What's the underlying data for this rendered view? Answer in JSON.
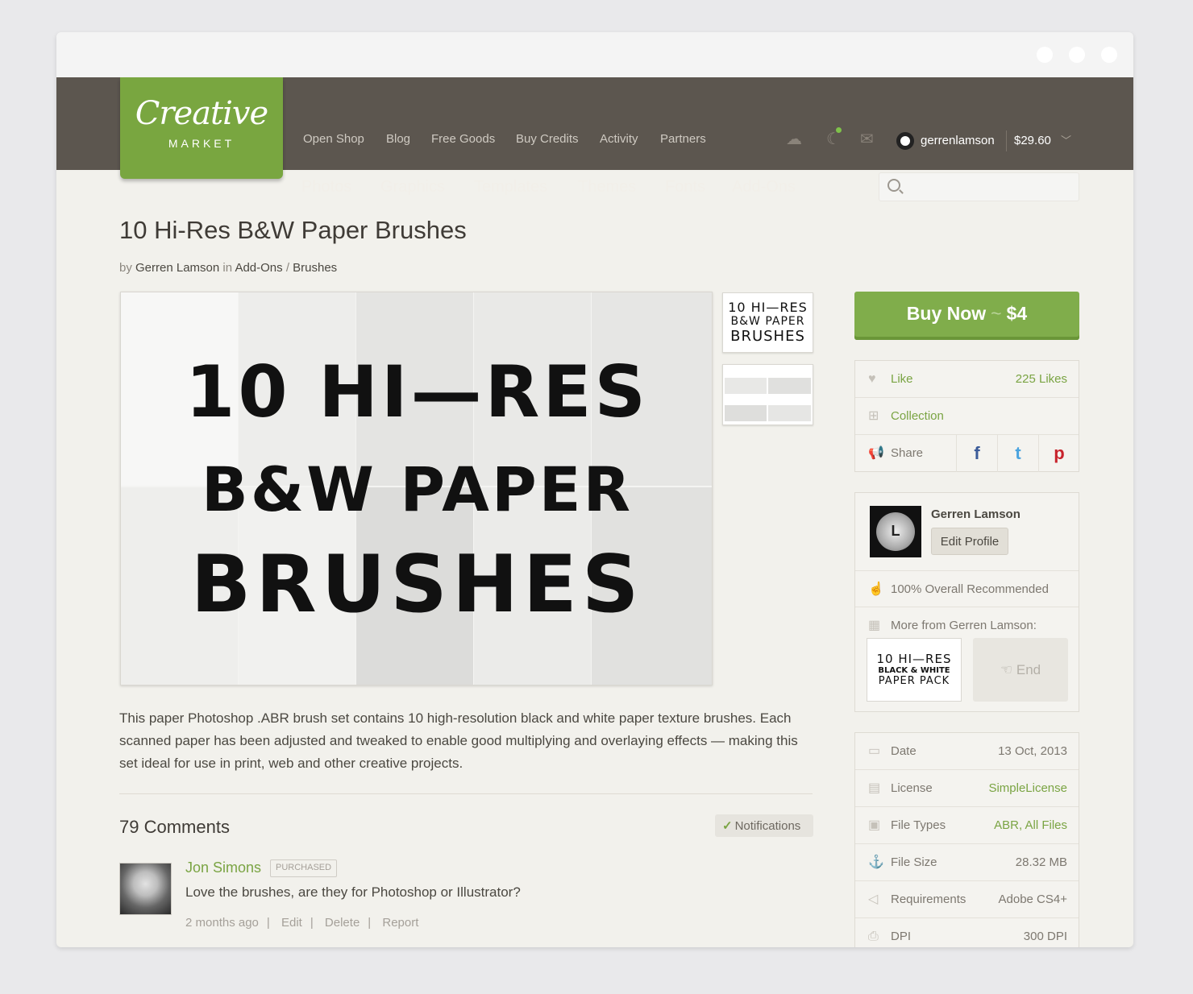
{
  "nav": {
    "logo_script": "Creative",
    "logo_sub": "MARKET",
    "sub_items": [
      "Open Shop",
      "Blog",
      "Free Goods",
      "Buy Credits",
      "Activity",
      "Partners"
    ],
    "main_items": [
      "Photos",
      "Graphics",
      "Templates",
      "Themes",
      "Fonts",
      "Add-Ons"
    ],
    "username": "gerrenlamson",
    "credits": "$29.60",
    "search_placeholder": ""
  },
  "product": {
    "title": "10 Hi-Res B&W Paper Brushes",
    "by": "by",
    "author": "Gerren Lamson",
    "in": "in",
    "category": "Add-Ons",
    "breadcrumb_sep": "/",
    "subcategory": "Brushes",
    "preview_lines": [
      "10 HI—RES",
      "B&W PAPER",
      "BRUSHES"
    ],
    "thumb_lines": [
      "10 HI—RES",
      "B&W PAPER",
      "BRUSHES"
    ],
    "description": "This paper Photoshop .ABR brush set contains 10 high-resolution black and white paper texture brushes. Each scanned paper has been adjusted and tweaked to enable good multiplying and overlaying effects — making this set ideal for use in print, web and other creative projects."
  },
  "comments": {
    "title": "79 Comments",
    "notifications": "Notifications",
    "items": [
      {
        "name": "Jon Simons",
        "badge": "PURCHASED",
        "text": "Love the brushes, are they for Photoshop or Illustrator?",
        "time": "2 months ago",
        "actions": [
          "Edit",
          "Delete",
          "Report"
        ]
      }
    ]
  },
  "sidebar": {
    "buy_label": "Buy Now",
    "buy_sep": "~",
    "price": "$4",
    "like": "Like",
    "likes_count": "225 Likes",
    "collection": "Collection",
    "share": "Share",
    "share_networks": [
      "f",
      "t",
      "p"
    ],
    "profile_name": "Gerren Lamson",
    "edit_profile": "Edit Profile",
    "recommended": "100% Overall Recommended",
    "more_from": "More from Gerren Lamson:",
    "more_thumb_lines": [
      "10 HI—RES",
      "BLACK & WHITE",
      "PAPER PACK"
    ],
    "end_label": "End",
    "details": [
      {
        "label": "Date",
        "value": "13 Oct, 2013",
        "link": false
      },
      {
        "label": "License",
        "value": "SimpleLicense",
        "link": true
      },
      {
        "label": "File Types",
        "value": "ABR, All Files",
        "link": true
      },
      {
        "label": "File Size",
        "value": "28.32 MB",
        "link": false
      },
      {
        "label": "Requirements",
        "value": "Adobe CS4+",
        "link": false
      },
      {
        "label": "DPI",
        "value": "300 DPI",
        "link": false
      }
    ]
  },
  "colors": {
    "nav_bg": "#5c564f",
    "brand_green": "#79a640",
    "link_green": "#7aa443",
    "page_bg": "#f2f1ec"
  }
}
